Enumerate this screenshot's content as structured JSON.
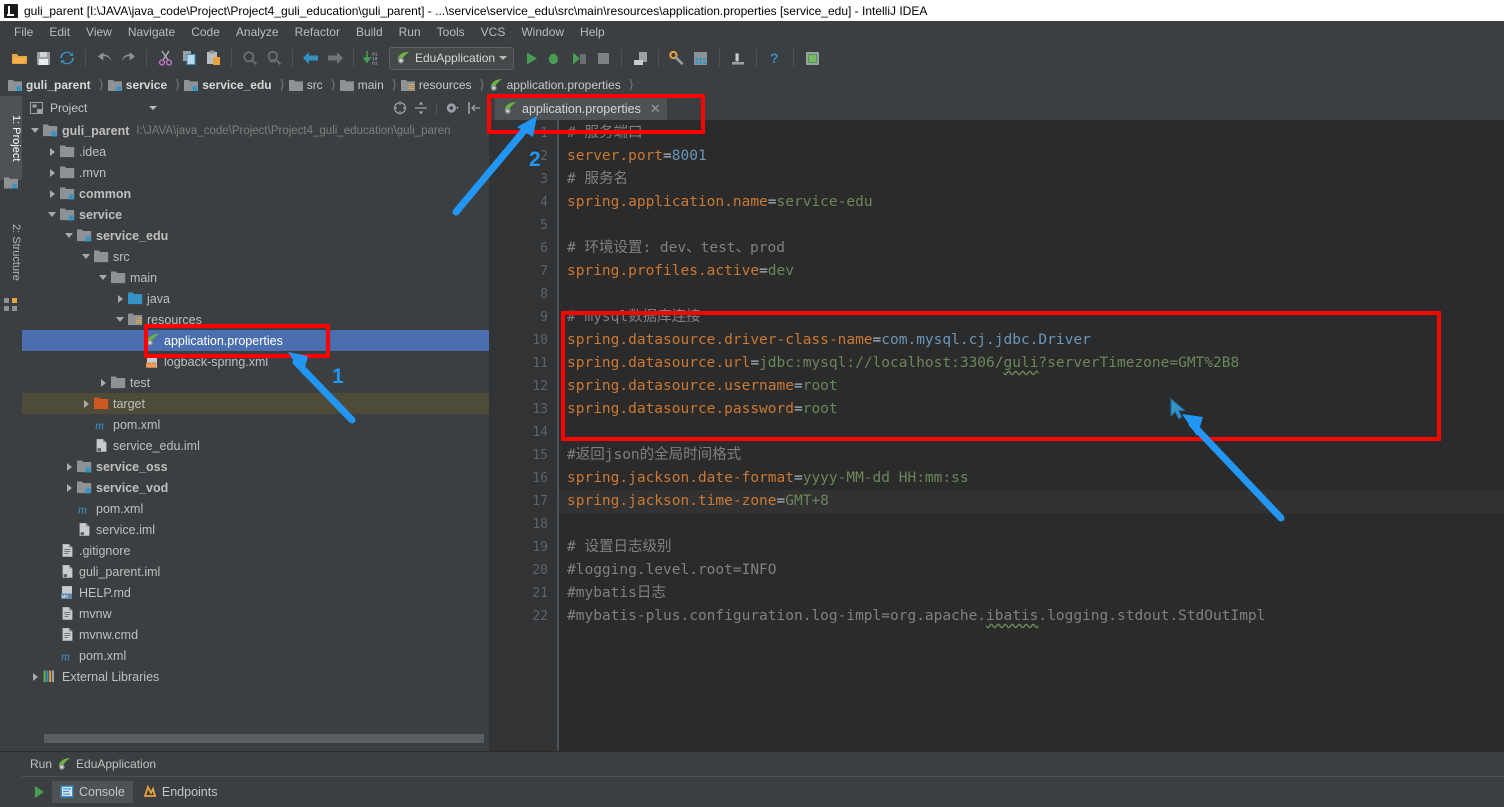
{
  "window": {
    "title": "guli_parent [I:\\JAVA\\java_code\\Project\\Project4_guli_education\\guli_parent] - ...\\service\\service_edu\\src\\main\\resources\\application.properties [service_edu] - IntelliJ IDEA",
    "app_icon": "intellij-idea-logo"
  },
  "menubar": {
    "items": [
      {
        "label": "File"
      },
      {
        "label": "Edit"
      },
      {
        "label": "View"
      },
      {
        "label": "Navigate"
      },
      {
        "label": "Code"
      },
      {
        "label": "Analyze"
      },
      {
        "label": "Refactor"
      },
      {
        "label": "Build"
      },
      {
        "label": "Run"
      },
      {
        "label": "Tools"
      },
      {
        "label": "VCS"
      },
      {
        "label": "Window"
      },
      {
        "label": "Help"
      }
    ]
  },
  "toolbar": {
    "buttons": [
      {
        "name": "open-project-icon",
        "title": "Open"
      },
      {
        "name": "save-all-icon",
        "title": "Save All"
      },
      {
        "name": "sync-refresh-icon",
        "title": "Synchronize"
      },
      {
        "name": "undo-icon",
        "title": "Undo"
      },
      {
        "name": "redo-icon",
        "title": "Redo"
      },
      {
        "name": "cut-icon",
        "title": "Cut"
      },
      {
        "name": "copy-icon",
        "title": "Copy"
      },
      {
        "name": "paste-icon",
        "title": "Paste"
      },
      {
        "name": "find-icon",
        "title": "Find"
      },
      {
        "name": "replace-icon",
        "title": "Replace"
      },
      {
        "name": "back-icon",
        "title": "Back"
      },
      {
        "name": "forward-icon",
        "title": "Forward"
      },
      {
        "name": "update-project-icon",
        "title": "Update Project"
      }
    ],
    "run_configuration": {
      "label": "EduApplication",
      "icon": "spring-boot-leaf-icon"
    },
    "right_buttons": [
      {
        "name": "run-icon",
        "title": "Run"
      },
      {
        "name": "debug-icon",
        "title": "Debug"
      },
      {
        "name": "run-coverage-icon",
        "title": "Run with Coverage"
      },
      {
        "name": "stop-icon",
        "title": "Stop"
      },
      {
        "name": "attach-process-icon",
        "title": "Attach"
      },
      {
        "name": "settings-wrench-icon",
        "title": "Settings"
      },
      {
        "name": "project-structure-icon",
        "title": "Project Structure"
      },
      {
        "name": "build-icon",
        "title": "Build"
      },
      {
        "name": "help-icon",
        "title": "Help"
      },
      {
        "name": "database-icon",
        "title": "Database"
      }
    ]
  },
  "breadcrumb": {
    "items": [
      {
        "label": "guli_parent",
        "icon": "module-icon",
        "bold": true
      },
      {
        "label": "service",
        "icon": "module-icon",
        "bold": true
      },
      {
        "label": "service_edu",
        "icon": "module-icon",
        "bold": true
      },
      {
        "label": "src",
        "icon": "folder-icon",
        "bold": false
      },
      {
        "label": "main",
        "icon": "folder-icon",
        "bold": false
      },
      {
        "label": "resources",
        "icon": "resources-folder-icon",
        "bold": false
      },
      {
        "label": "application.properties",
        "icon": "spring-properties-icon",
        "bold": false
      }
    ]
  },
  "left_tool_strip": {
    "tabs": [
      {
        "label": "1: Project",
        "active": true,
        "icon": "project-icon"
      },
      {
        "label": "2: Structure",
        "active": false,
        "icon": "structure-icon"
      }
    ]
  },
  "project_panel": {
    "title": "Project",
    "header_icons": [
      {
        "name": "collapse-target-icon"
      },
      {
        "name": "expand-collapse-icon"
      },
      {
        "name": "gear-icon"
      },
      {
        "name": "hide-panel-icon"
      }
    ],
    "tree": [
      {
        "depth": 0,
        "arrow": "down",
        "icon": "module-icon",
        "label": "guli_parent",
        "bold": true,
        "path": "I:\\JAVA\\java_code\\Project\\Project4_guli_education\\guli_paren",
        "state": "normal"
      },
      {
        "depth": 1,
        "arrow": "right",
        "icon": "folder-icon",
        "label": ".idea",
        "bold": false,
        "path": "",
        "state": "normal"
      },
      {
        "depth": 1,
        "arrow": "right",
        "icon": "folder-icon",
        "label": ".mvn",
        "bold": false,
        "path": "",
        "state": "normal"
      },
      {
        "depth": 1,
        "arrow": "right",
        "icon": "module-icon",
        "label": "common",
        "bold": true,
        "path": "",
        "state": "normal"
      },
      {
        "depth": 1,
        "arrow": "down",
        "icon": "module-icon",
        "label": "service",
        "bold": true,
        "path": "",
        "state": "normal"
      },
      {
        "depth": 2,
        "arrow": "down",
        "icon": "module-icon",
        "label": "service_edu",
        "bold": true,
        "path": "",
        "state": "normal"
      },
      {
        "depth": 3,
        "arrow": "down",
        "icon": "folder-icon",
        "label": "src",
        "bold": false,
        "path": "",
        "state": "normal"
      },
      {
        "depth": 4,
        "arrow": "down",
        "icon": "folder-icon",
        "label": "main",
        "bold": false,
        "path": "",
        "state": "normal"
      },
      {
        "depth": 5,
        "arrow": "right",
        "icon": "source-folder-icon",
        "label": "java",
        "bold": false,
        "path": "",
        "state": "normal"
      },
      {
        "depth": 5,
        "arrow": "down",
        "icon": "resources-folder-icon",
        "label": "resources",
        "bold": false,
        "path": "",
        "state": "normal"
      },
      {
        "depth": 6,
        "arrow": "none",
        "icon": "spring-properties-icon",
        "label": "application.properties",
        "bold": false,
        "path": "",
        "state": "selected"
      },
      {
        "depth": 6,
        "arrow": "none",
        "icon": "xml-file-icon",
        "label": "logback-spring.xml",
        "bold": false,
        "path": "",
        "state": "normal"
      },
      {
        "depth": 4,
        "arrow": "right",
        "icon": "folder-icon",
        "label": "test",
        "bold": false,
        "path": "",
        "state": "normal"
      },
      {
        "depth": 3,
        "arrow": "right",
        "icon": "target-folder-icon",
        "label": "target",
        "bold": false,
        "path": "",
        "state": "inactive"
      },
      {
        "depth": 3,
        "arrow": "none",
        "icon": "maven-pom-icon",
        "label": "pom.xml",
        "bold": false,
        "path": "",
        "state": "normal"
      },
      {
        "depth": 3,
        "arrow": "none",
        "icon": "iml-file-icon",
        "label": "service_edu.iml",
        "bold": false,
        "path": "",
        "state": "normal"
      },
      {
        "depth": 2,
        "arrow": "right",
        "icon": "module-icon",
        "label": "service_oss",
        "bold": true,
        "path": "",
        "state": "normal"
      },
      {
        "depth": 2,
        "arrow": "right",
        "icon": "module-icon",
        "label": "service_vod",
        "bold": true,
        "path": "",
        "state": "normal"
      },
      {
        "depth": 2,
        "arrow": "none",
        "icon": "maven-pom-icon",
        "label": "pom.xml",
        "bold": false,
        "path": "",
        "state": "normal"
      },
      {
        "depth": 2,
        "arrow": "none",
        "icon": "iml-file-icon",
        "label": "service.iml",
        "bold": false,
        "path": "",
        "state": "normal"
      },
      {
        "depth": 1,
        "arrow": "none",
        "icon": "text-file-icon",
        "label": ".gitignore",
        "bold": false,
        "path": "",
        "state": "normal"
      },
      {
        "depth": 1,
        "arrow": "none",
        "icon": "iml-file-icon",
        "label": "guli_parent.iml",
        "bold": false,
        "path": "",
        "state": "normal"
      },
      {
        "depth": 1,
        "arrow": "none",
        "icon": "markdown-file-icon",
        "label": "HELP.md",
        "bold": false,
        "path": "",
        "state": "normal"
      },
      {
        "depth": 1,
        "arrow": "none",
        "icon": "text-file-icon",
        "label": "mvnw",
        "bold": false,
        "path": "",
        "state": "normal"
      },
      {
        "depth": 1,
        "arrow": "none",
        "icon": "text-file-icon",
        "label": "mvnw.cmd",
        "bold": false,
        "path": "",
        "state": "normal"
      },
      {
        "depth": 1,
        "arrow": "none",
        "icon": "maven-pom-icon",
        "label": "pom.xml",
        "bold": false,
        "path": "",
        "state": "normal"
      },
      {
        "depth": 0,
        "arrow": "right",
        "icon": "external-libraries-icon",
        "label": "External Libraries",
        "bold": false,
        "path": "",
        "state": "normal"
      }
    ]
  },
  "editor": {
    "tab": {
      "label": "application.properties",
      "icon": "spring-properties-icon",
      "close_icon": "close-icon"
    },
    "lines": [
      {
        "no": "1",
        "highlight": false,
        "tokens": [
          {
            "t": "# 服务端口",
            "c": "c"
          }
        ]
      },
      {
        "no": "2",
        "highlight": false,
        "tokens": [
          {
            "t": "server.port",
            "c": "k"
          },
          {
            "t": "=",
            "c": "eq"
          },
          {
            "t": "8001",
            "c": "n"
          }
        ]
      },
      {
        "no": "3",
        "highlight": false,
        "tokens": [
          {
            "t": "# 服务名",
            "c": "c"
          }
        ]
      },
      {
        "no": "4",
        "highlight": false,
        "tokens": [
          {
            "t": "spring.application.name",
            "c": "k"
          },
          {
            "t": "=",
            "c": "eq"
          },
          {
            "t": "service-edu",
            "c": "v"
          }
        ]
      },
      {
        "no": "5",
        "highlight": false,
        "tokens": []
      },
      {
        "no": "6",
        "highlight": false,
        "tokens": [
          {
            "t": "# 环境设置: dev、test、prod",
            "c": "c"
          }
        ]
      },
      {
        "no": "7",
        "highlight": false,
        "tokens": [
          {
            "t": "spring.profiles.active",
            "c": "k"
          },
          {
            "t": "=",
            "c": "eq"
          },
          {
            "t": "dev",
            "c": "v"
          }
        ]
      },
      {
        "no": "8",
        "highlight": false,
        "tokens": []
      },
      {
        "no": "9",
        "highlight": false,
        "tokens": [
          {
            "t": "# mysql数据库连接",
            "c": "c"
          }
        ]
      },
      {
        "no": "10",
        "highlight": false,
        "tokens": [
          {
            "t": "spring.datasource.driver-class-name",
            "c": "k"
          },
          {
            "t": "=",
            "c": "eq"
          },
          {
            "t": "com.mysql.cj.jdbc.Driver",
            "c": "n"
          }
        ]
      },
      {
        "no": "11",
        "highlight": false,
        "tokens": [
          {
            "t": "spring.datasource.url",
            "c": "k"
          },
          {
            "t": "=",
            "c": "eq"
          },
          {
            "t": "jdbc:mysql://localhost:3306/",
            "c": "v"
          },
          {
            "t": "guli",
            "c": "v wavy"
          },
          {
            "t": "?serverTimezone=GMT%2B8",
            "c": "v"
          }
        ]
      },
      {
        "no": "12",
        "highlight": false,
        "tokens": [
          {
            "t": "spring.datasource.username",
            "c": "k"
          },
          {
            "t": "=",
            "c": "eq"
          },
          {
            "t": "root",
            "c": "v"
          }
        ]
      },
      {
        "no": "13",
        "highlight": false,
        "tokens": [
          {
            "t": "spring.datasource.password",
            "c": "k"
          },
          {
            "t": "=",
            "c": "eq"
          },
          {
            "t": "root",
            "c": "v"
          }
        ]
      },
      {
        "no": "14",
        "highlight": false,
        "tokens": []
      },
      {
        "no": "15",
        "highlight": false,
        "tokens": [
          {
            "t": "#返回json的全局时间格式",
            "c": "c"
          }
        ]
      },
      {
        "no": "16",
        "highlight": false,
        "tokens": [
          {
            "t": "spring.jackson.date-format",
            "c": "k"
          },
          {
            "t": "=",
            "c": "eq"
          },
          {
            "t": "yyyy-MM-dd HH:mm:ss",
            "c": "v"
          }
        ]
      },
      {
        "no": "17",
        "highlight": true,
        "tokens": [
          {
            "t": "spring.jackson.time-zone",
            "c": "k"
          },
          {
            "t": "=",
            "c": "eq"
          },
          {
            "t": "GMT+8",
            "c": "v"
          }
        ]
      },
      {
        "no": "18",
        "highlight": false,
        "tokens": []
      },
      {
        "no": "19",
        "highlight": false,
        "tokens": [
          {
            "t": "# 设置日志级别",
            "c": "c"
          }
        ]
      },
      {
        "no": "20",
        "highlight": false,
        "tokens": [
          {
            "t": "#logging.level.root=INFO",
            "c": "c"
          }
        ]
      },
      {
        "no": "21",
        "highlight": false,
        "tokens": [
          {
            "t": "#mybatis日志",
            "c": "c"
          }
        ]
      },
      {
        "no": "22",
        "highlight": false,
        "tokens": [
          {
            "t": "#mybatis-plus.configuration.log-impl=org.apache.",
            "c": "c"
          },
          {
            "t": "ibatis",
            "c": "c wavy"
          },
          {
            "t": ".logging.stdout.StdOutImpl",
            "c": "c"
          }
        ]
      }
    ]
  },
  "run_panel": {
    "header_label": "Run",
    "header_config": "EduApplication",
    "header_icon": "spring-boot-leaf-icon",
    "rerun_icon": "run-icon",
    "tabs": [
      {
        "label": "Console",
        "icon": "console-icon",
        "active": true
      },
      {
        "label": "Endpoints",
        "icon": "endpoints-icon",
        "active": false
      }
    ]
  },
  "annotations": {
    "markers": [
      {
        "label": "1"
      },
      {
        "label": "2"
      }
    ],
    "highlight_color": "#ff0000",
    "arrow_color": "#2196f3"
  }
}
